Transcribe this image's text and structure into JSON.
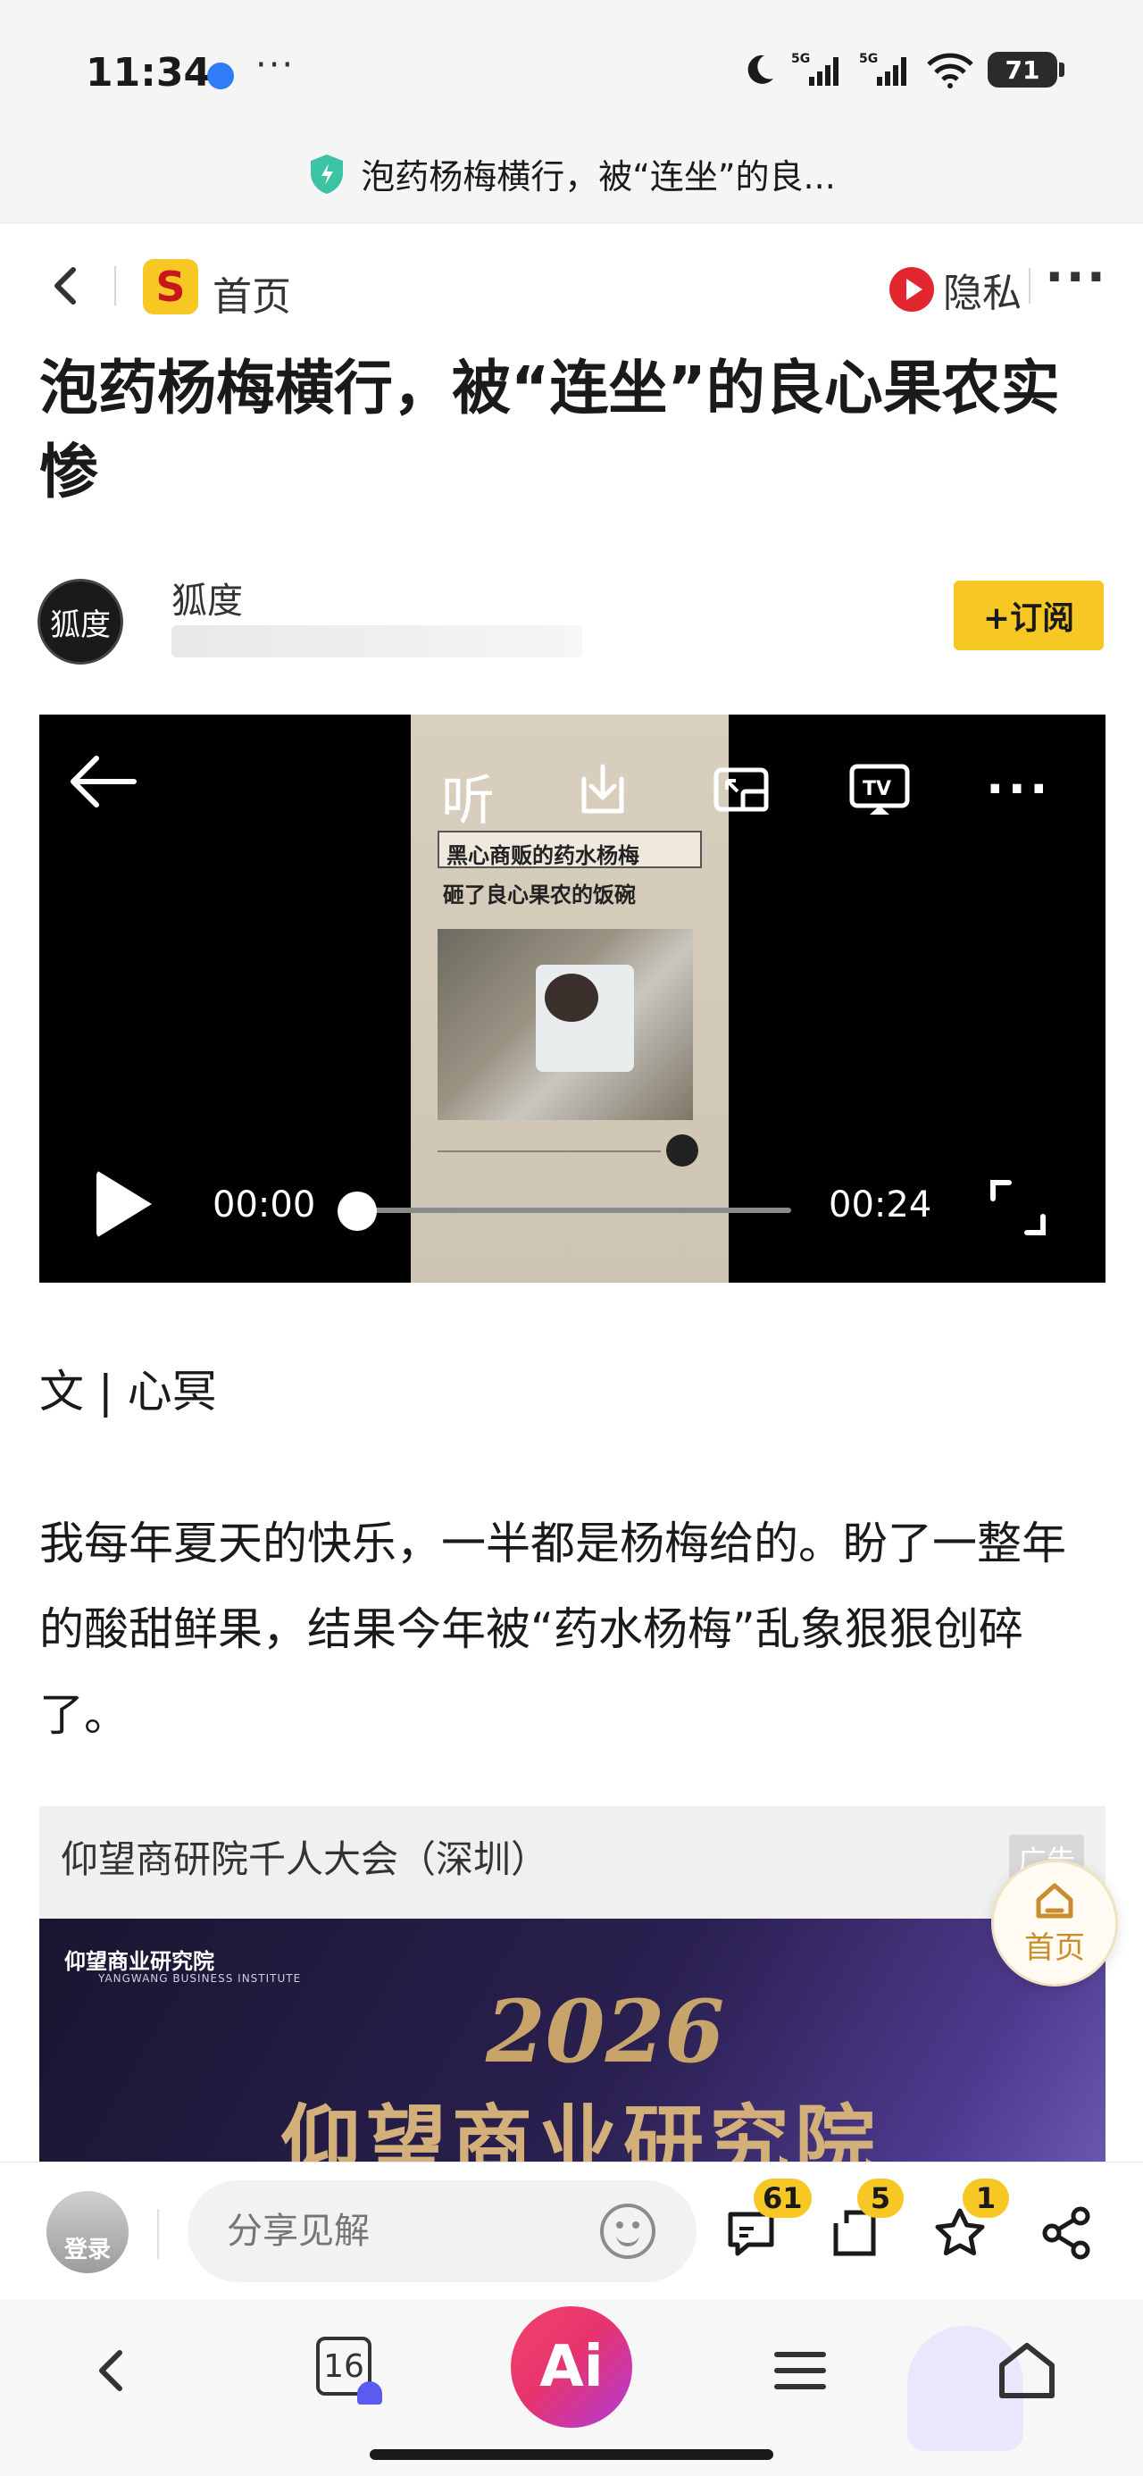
{
  "status_bar": {
    "time": "11:34",
    "more": "···",
    "network": "5G",
    "battery": "71"
  },
  "url_bar": {
    "title": "泡药杨梅横行，被“连坐”的良..."
  },
  "top_nav": {
    "home_label": "首页",
    "logo_letter": "S",
    "privacy_label": "隐私",
    "more": "···"
  },
  "article": {
    "title": "泡药杨梅横行，被“连坐”的良心果农实惨",
    "author": "狐度",
    "author_avatar_text": "狐度",
    "subscribe_label": "+订阅",
    "byline": "文 | 心冥",
    "paragraph": "我每年夏天的快乐，一半都是杨梅给的。盼了一整年的酸甜鲜果，结果今年被“药水杨梅”乱象狠狠创碎了。"
  },
  "video": {
    "listen_label": "听",
    "caption_line1": "黑心商贩的药水杨梅",
    "caption_line2": "砸了良心果农的饭碗",
    "current_time": "00:00",
    "duration": "00:24",
    "progress": 0,
    "tv_label": "TV"
  },
  "ad": {
    "title": "仰望商研院千人大会（深圳）",
    "badge": "广告",
    "logo_text": "仰望商业研究院",
    "logo_sub": "YANGWANG BUSINESS INSTITUTE",
    "year": "2026",
    "headline": "仰望商业研究院"
  },
  "float_home": {
    "label": "首页"
  },
  "comment_bar": {
    "login_label": "登录",
    "input_placeholder": "分享见解",
    "comments_count": "61",
    "reposts_count": "5",
    "favorites_count": "1"
  },
  "browser_bar": {
    "tabs_count": "16",
    "ai_label": "Ai"
  },
  "colors": {
    "accent_yellow": "#f7c824",
    "privacy_red": "#e2262f",
    "ai_gradient_start": "#f2436a",
    "ai_gradient_end": "#b23bd8"
  }
}
